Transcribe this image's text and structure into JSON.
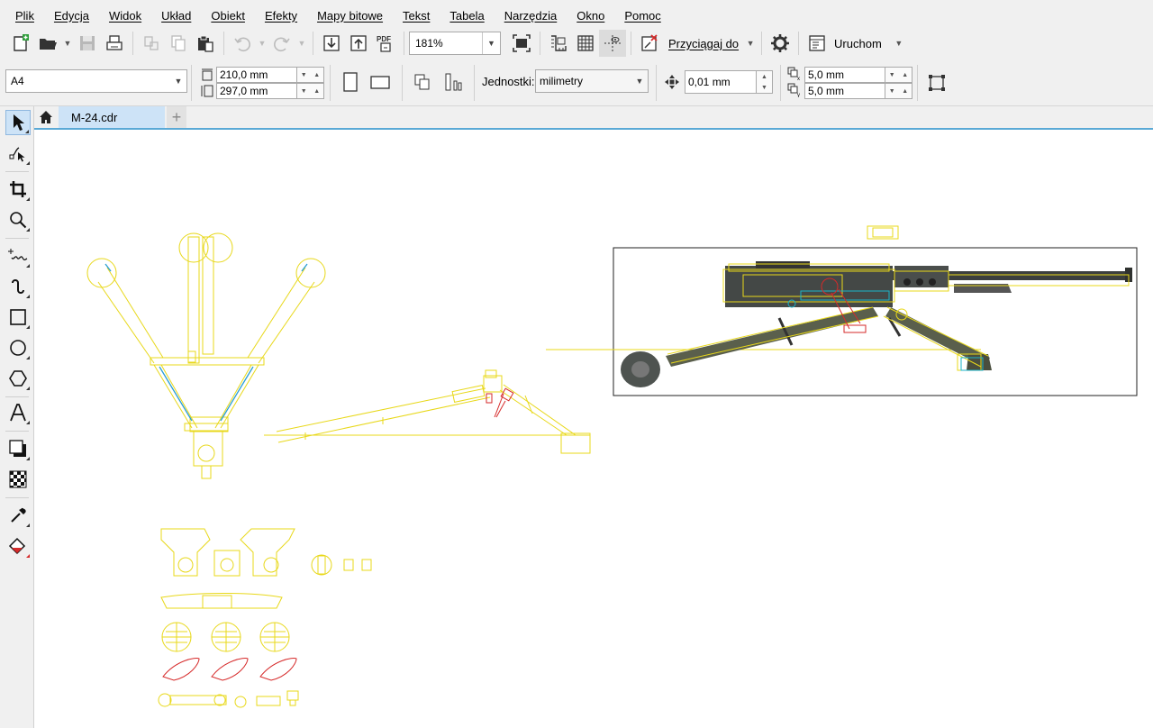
{
  "menu": {
    "items": [
      "Plik",
      "Edycja",
      "Widok",
      "Układ",
      "Obiekt",
      "Efekty",
      "Mapy bitowe",
      "Tekst",
      "Tabela",
      "Narzędzia",
      "Okno",
      "Pomoc"
    ]
  },
  "toolbar": {
    "zoom_value": "181%",
    "snap_label": "Przyciągaj do",
    "run_label": "Uruchom",
    "pdf_icon_text": "PDF"
  },
  "property_bar": {
    "page_size": "A4",
    "width": "210,0 mm",
    "height": "297,0 mm",
    "units_label": "Jednostki:",
    "units_value": "milimetry",
    "nudge": "0,01 mm",
    "dup_x": "5,0 mm",
    "dup_y": "5,0 mm"
  },
  "document": {
    "tab_name": "M-24.cdr"
  },
  "colors": {
    "outline_yellow": "#e8d81a",
    "outline_blue": "#2a9fd6",
    "outline_red": "#d62a2a",
    "outline_cyan": "#1ab3c8",
    "tab_active": "#cde3f7",
    "chrome": "#f0f0f0"
  },
  "tools": [
    "pick-tool-icon",
    "shape-tool-icon",
    "crop-tool-icon",
    "zoom-tool-icon",
    "freehand-tool-icon",
    "artistic-media-tool-icon",
    "rectangle-tool-icon",
    "ellipse-tool-icon",
    "polygon-tool-icon",
    "text-tool-icon",
    "drop-shadow-tool-icon",
    "transparency-tool-icon",
    "eyedropper-tool-icon",
    "interactive-fill-tool-icon"
  ]
}
